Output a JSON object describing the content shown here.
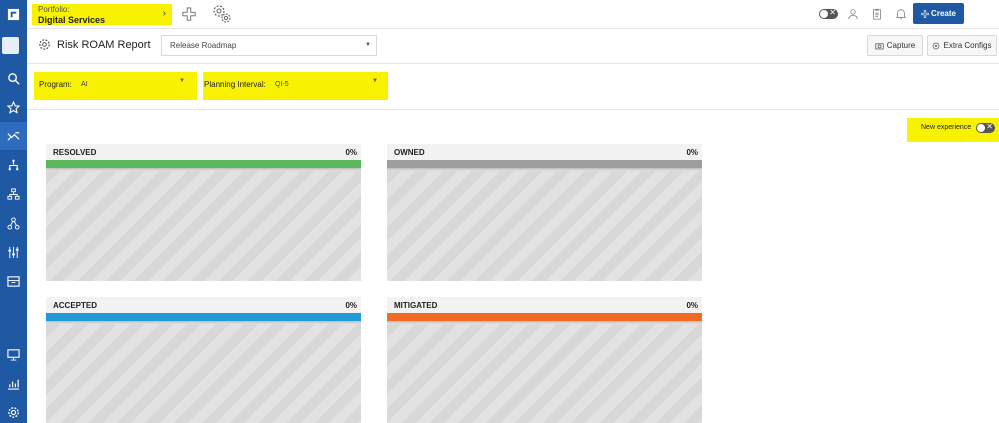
{
  "topbar": {
    "portfolio_label": "Portfolio:",
    "portfolio_value": "Digital Services",
    "create_label": "Create"
  },
  "header": {
    "page_title": "Risk ROAM Report",
    "roadmap_select": "Release Roadmap",
    "capture_label": "Capture",
    "extra_configs_label": "Extra Configs"
  },
  "filters": {
    "program_label": "Program:",
    "program_value": "AI",
    "pi_label": "Planning Interval:",
    "pi_value": "QI-5"
  },
  "new_experience_label": "New experience",
  "panels": [
    {
      "title": "RESOLVED",
      "percent": "0%",
      "color": "#5cb85c"
    },
    {
      "title": "OWNED",
      "percent": "0%",
      "color": "#9e9e9e"
    },
    {
      "title": "ACCEPTED",
      "percent": "0%",
      "color": "#1f9ad6"
    },
    {
      "title": "MITIGATED",
      "percent": "0%",
      "color": "#f26a25"
    }
  ],
  "colors": {
    "brand": "#1f58a3",
    "highlight": "#f8f200"
  },
  "icons": {
    "rail": [
      "logo-icon",
      "search-icon",
      "star-icon",
      "roadmap-icon",
      "hierarchy-icon",
      "org-chart-icon",
      "network-icon",
      "sliders-icon",
      "archive-icon",
      "presentation-icon",
      "chart-icon",
      "settings-icon"
    ],
    "topbar": [
      "add-icon",
      "settings-gear-icon",
      "user-icon",
      "clipboard-icon",
      "bell-icon",
      "search-icon"
    ]
  }
}
